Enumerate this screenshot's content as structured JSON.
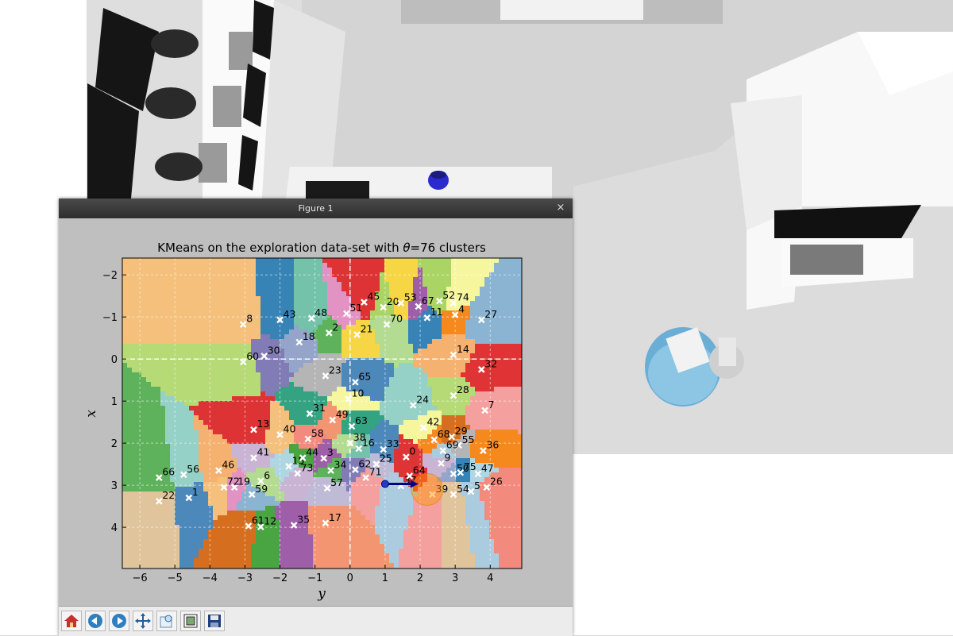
{
  "window": {
    "title": "Figure 1",
    "close_symbol": "×"
  },
  "toolbar": {
    "buttons": [
      {
        "name": "home-icon",
        "label": "Home"
      },
      {
        "name": "back-icon",
        "label": "Back"
      },
      {
        "name": "forward-icon",
        "label": "Forward"
      },
      {
        "name": "pan-icon",
        "label": "Pan"
      },
      {
        "name": "zoom-icon",
        "label": "Zoom"
      },
      {
        "name": "subplots-icon",
        "label": "Subplots"
      },
      {
        "name": "save-icon",
        "label": "Save"
      }
    ]
  },
  "chart_data": {
    "type": "scatter",
    "title_prefix": "KMeans on the exploration data-set with ",
    "title_theta": "θ",
    "title_suffix": "=76 clusters",
    "xlabel": "y",
    "ylabel": "x",
    "xlim": [
      -6.5,
      4.9
    ],
    "ylim": [
      4.98,
      -2.4
    ],
    "xticks": [
      -6,
      -5,
      -4,
      -3,
      -2,
      -1,
      0,
      1,
      2,
      3,
      4
    ],
    "yticks": [
      -2,
      -1,
      0,
      1,
      2,
      3,
      4
    ],
    "grid": true,
    "centroids": [
      {
        "label": "0",
        "x": 1.6,
        "y": 2.33
      },
      {
        "label": "1",
        "x": -4.6,
        "y": 3.3
      },
      {
        "label": "2",
        "x": -0.6,
        "y": -0.62
      },
      {
        "label": "3",
        "x": -0.75,
        "y": 2.36
      },
      {
        "label": "4",
        "x": 3.0,
        "y": -1.05
      },
      {
        "label": "5",
        "x": 3.45,
        "y": 3.15
      },
      {
        "label": "6",
        "x": -2.55,
        "y": 2.9
      },
      {
        "label": "7",
        "x": 3.85,
        "y": 1.22
      },
      {
        "label": "8",
        "x": -3.05,
        "y": -0.82
      },
      {
        "label": "9",
        "x": 2.6,
        "y": 2.48
      },
      {
        "label": "10",
        "x": -0.05,
        "y": 0.95
      },
      {
        "label": "11",
        "x": 2.2,
        "y": -0.98
      },
      {
        "label": "12",
        "x": -2.55,
        "y": 3.99
      },
      {
        "label": "13",
        "x": -2.75,
        "y": 1.68
      },
      {
        "label": "14",
        "x": 2.95,
        "y": -0.1
      },
      {
        "label": "15",
        "x": -1.75,
        "y": 2.55
      },
      {
        "label": "16",
        "x": 0.25,
        "y": 2.13
      },
      {
        "label": "17",
        "x": -0.7,
        "y": 3.9
      },
      {
        "label": "18",
        "x": -1.45,
        "y": -0.4
      },
      {
        "label": "19",
        "x": -3.3,
        "y": 3.05
      },
      {
        "label": "20",
        "x": 0.95,
        "y": -1.23
      },
      {
        "label": "21",
        "x": 0.2,
        "y": -0.58
      },
      {
        "label": "22",
        "x": -5.45,
        "y": 3.38
      },
      {
        "label": "23",
        "x": -0.7,
        "y": 0.4
      },
      {
        "label": "24",
        "x": 1.8,
        "y": 1.1
      },
      {
        "label": "25",
        "x": 0.75,
        "y": 2.5
      },
      {
        "label": "26",
        "x": 3.9,
        "y": 3.05
      },
      {
        "label": "27",
        "x": 3.75,
        "y": -0.93
      },
      {
        "label": "28",
        "x": 2.95,
        "y": 0.87
      },
      {
        "label": "29",
        "x": 2.9,
        "y": 1.85
      },
      {
        "label": "30",
        "x": -2.45,
        "y": -0.07
      },
      {
        "label": "31",
        "x": -1.15,
        "y": 1.3
      },
      {
        "label": "32",
        "x": 3.75,
        "y": 0.25
      },
      {
        "label": "33",
        "x": 0.95,
        "y": 2.15
      },
      {
        "label": "34",
        "x": -0.55,
        "y": 2.65
      },
      {
        "label": "35",
        "x": -1.6,
        "y": 3.95
      },
      {
        "label": "36",
        "x": 3.8,
        "y": 2.18
      },
      {
        "label": "37",
        "x": 1.45,
        "y": 3.02
      },
      {
        "label": "38",
        "x": 0.0,
        "y": 2.0
      },
      {
        "label": "39",
        "x": 2.35,
        "y": 3.22
      },
      {
        "label": "40",
        "x": -2.0,
        "y": 1.8
      },
      {
        "label": "41",
        "x": -2.75,
        "y": 2.35
      },
      {
        "label": "42",
        "x": 2.1,
        "y": 1.63
      },
      {
        "label": "43",
        "x": -2.0,
        "y": -0.93
      },
      {
        "label": "44",
        "x": -1.35,
        "y": 2.35
      },
      {
        "label": "45",
        "x": 0.4,
        "y": -1.35
      },
      {
        "label": "46",
        "x": -3.75,
        "y": 2.65
      },
      {
        "label": "47",
        "x": 3.65,
        "y": 2.73
      },
      {
        "label": "48",
        "x": -1.1,
        "y": -0.97
      },
      {
        "label": "49",
        "x": -0.5,
        "y": 1.45
      },
      {
        "label": "50",
        "x": 2.95,
        "y": 2.73
      },
      {
        "label": "51",
        "x": -0.1,
        "y": -1.08
      },
      {
        "label": "52",
        "x": 2.55,
        "y": -1.38
      },
      {
        "label": "53",
        "x": 1.45,
        "y": -1.33
      },
      {
        "label": "54",
        "x": 2.95,
        "y": 3.22
      },
      {
        "label": "55",
        "x": 3.1,
        "y": 2.05
      },
      {
        "label": "56",
        "x": -4.75,
        "y": 2.75
      },
      {
        "label": "57",
        "x": -0.65,
        "y": 3.07
      },
      {
        "label": "58",
        "x": -1.2,
        "y": 1.9
      },
      {
        "label": "59",
        "x": -2.8,
        "y": 3.22
      },
      {
        "label": "60",
        "x": -3.05,
        "y": 0.07
      },
      {
        "label": "61",
        "x": -2.9,
        "y": 3.97
      },
      {
        "label": "62",
        "x": 0.15,
        "y": 2.63
      },
      {
        "label": "63",
        "x": 0.05,
        "y": 1.6
      },
      {
        "label": "64",
        "x": 1.7,
        "y": 2.78
      },
      {
        "label": "65",
        "x": 0.15,
        "y": 0.55
      },
      {
        "label": "66",
        "x": -5.45,
        "y": 2.82
      },
      {
        "label": "67",
        "x": 1.95,
        "y": -1.25
      },
      {
        "label": "68",
        "x": 2.4,
        "y": 1.92
      },
      {
        "label": "69",
        "x": 2.65,
        "y": 2.18
      },
      {
        "label": "70",
        "x": 1.05,
        "y": -0.82
      },
      {
        "label": "71",
        "x": 0.45,
        "y": 2.82
      },
      {
        "label": "72",
        "x": -3.6,
        "y": 3.05
      },
      {
        "label": "73",
        "x": -1.5,
        "y": 2.72
      },
      {
        "label": "74",
        "x": 2.95,
        "y": -1.33
      },
      {
        "label": "75",
        "x": 3.15,
        "y": 2.7
      }
    ],
    "robot_marker": {
      "x": 1.0,
      "y": 2.97
    },
    "robot_arrow_end": {
      "x": 1.95,
      "y": 2.97
    },
    "goal_circle": {
      "x": 2.2,
      "y": 3.1
    }
  }
}
